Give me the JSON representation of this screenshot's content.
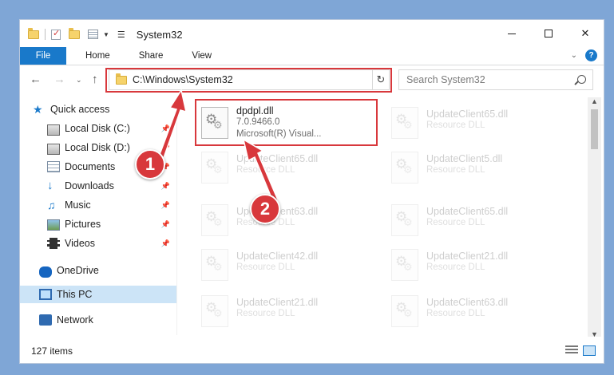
{
  "window": {
    "title": "System32",
    "controls": {
      "minimize": "minimize",
      "maximize": "maximize",
      "close": "✕"
    }
  },
  "ribbon": {
    "tabs": [
      "File",
      "Home",
      "Share",
      "View"
    ],
    "help": "?"
  },
  "address": {
    "path": "C:\\Windows\\System32",
    "search_placeholder": "Search System32"
  },
  "nav": {
    "items": [
      {
        "label": "Quick access",
        "icon": "star-icon",
        "pinned": false
      },
      {
        "label": "Local Disk (C:)",
        "icon": "drive-icon",
        "pinned": true
      },
      {
        "label": "Local Disk (D:)",
        "icon": "drive-icon",
        "pinned": true
      },
      {
        "label": "Documents",
        "icon": "document-icon",
        "pinned": true
      },
      {
        "label": "Downloads",
        "icon": "download-icon",
        "pinned": true
      },
      {
        "label": "Music",
        "icon": "music-icon",
        "pinned": true
      },
      {
        "label": "Pictures",
        "icon": "picture-icon",
        "pinned": true
      },
      {
        "label": "Videos",
        "icon": "video-icon",
        "pinned": true
      },
      {
        "label": "OneDrive",
        "icon": "cloud-icon",
        "pinned": false
      },
      {
        "label": "This PC",
        "icon": "computer-icon",
        "pinned": false,
        "selected": true
      },
      {
        "label": "Network",
        "icon": "network-icon",
        "pinned": false
      }
    ]
  },
  "files": {
    "selected": {
      "name": "dpdpl.dll",
      "version": "7.0.9466.0",
      "company": "Microsoft(R) Visual..."
    },
    "left_column": [
      {
        "name": "UpdateClient65.dll",
        "type": "Resource DLL"
      },
      {
        "name": "UpdateClient63.dll",
        "type": "Resource DLL"
      },
      {
        "name": "UpdateClient42.dll",
        "type": "Resource DLL"
      },
      {
        "name": "UpdateClient21.dll",
        "type": "Resource DLL"
      }
    ],
    "right_column": [
      {
        "name": "UpdateClient65.dll",
        "type": "Resource DLL"
      },
      {
        "name": "UpdateClient5.dll",
        "type": "Resource DLL"
      },
      {
        "name": "UpdateClient65.dll",
        "type": "Resource DLL"
      },
      {
        "name": "UpdateClient21.dll",
        "type": "Resource DLL"
      },
      {
        "name": "UpdateClient63.dll",
        "type": "Resource DLL"
      }
    ]
  },
  "status": {
    "item_count": "127 items"
  },
  "callouts": [
    "1",
    "2"
  ],
  "colors": {
    "accent": "#1979ca",
    "highlight": "#d8383c"
  }
}
